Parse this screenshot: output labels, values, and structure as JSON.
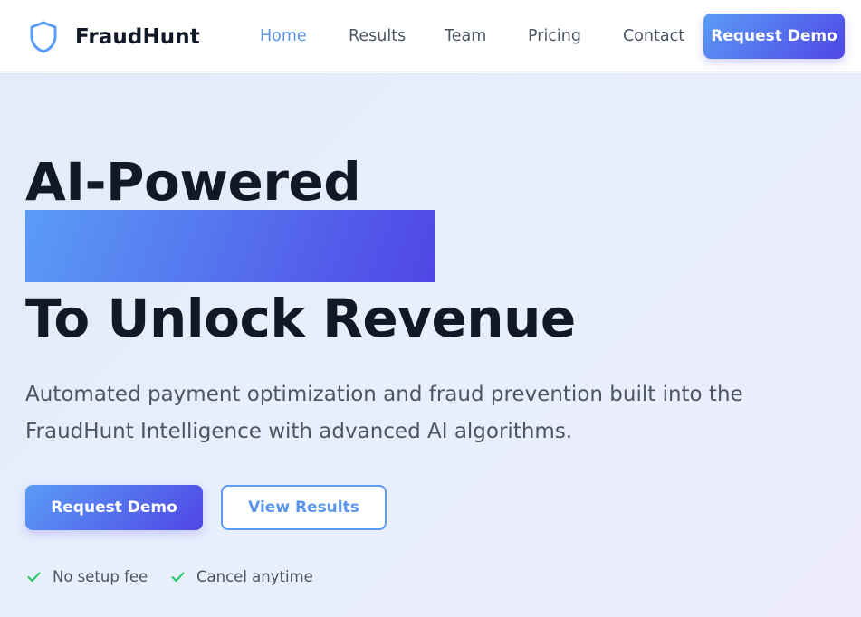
{
  "brand": {
    "name": "FraudHunt",
    "icon": "shield-icon",
    "accent_color": "#5b9cf6",
    "gradient_end": "#4f46e5"
  },
  "nav": {
    "items": [
      {
        "label": "Home",
        "active": true
      },
      {
        "label": "Results",
        "active": false
      },
      {
        "label": "Team",
        "active": false
      },
      {
        "label": "Pricing",
        "active": false
      },
      {
        "label": "Contact",
        "active": false
      }
    ],
    "cta_label": "Request Demo"
  },
  "hero": {
    "headline_line1": "AI-Powered",
    "headline_line3": "To Unlock Revenue",
    "description": "Automated payment optimization and fraud prevention built into the FraudHunt Intelligence with advanced AI algorithms.",
    "primary_button": "Request Demo",
    "secondary_button": "View Results",
    "features": [
      {
        "icon": "check-icon",
        "label": "No setup fee",
        "color": "#22c55e"
      },
      {
        "icon": "check-icon",
        "label": "Cancel anytime",
        "color": "#22c55e"
      }
    ]
  }
}
